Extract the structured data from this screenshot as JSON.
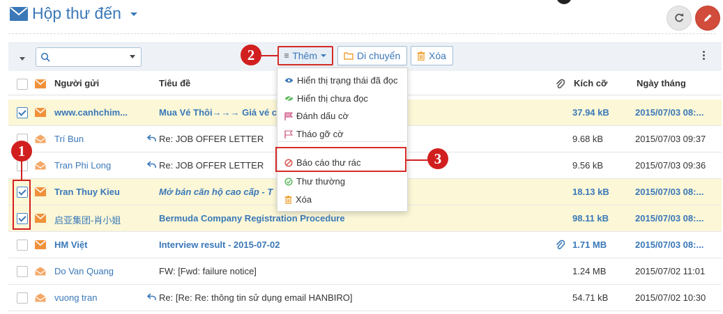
{
  "header": {
    "title": "Hộp thư đến",
    "icons": [
      "envelope-icon",
      "refresh-icon",
      "pencil-icon"
    ]
  },
  "toolbar": {
    "search_placeholder": "",
    "more_label": "Thêm",
    "move_label": "Di chuyển",
    "delete_label": "Xóa"
  },
  "columns": {
    "sender": "Người gửi",
    "subject": "Tiêu đề",
    "size": "Kích cỡ",
    "date": "Ngày tháng"
  },
  "menu": {
    "items": [
      {
        "label": "Hiển thị trạng thái đã đọc",
        "icon": "eye-icon",
        "color": "#3a78b8"
      },
      {
        "label": "Hiển thị chưa đọc",
        "icon": "eye-slash-icon",
        "color": "#5cb85c"
      },
      {
        "label": "Đánh dấu cờ",
        "icon": "flag-icon",
        "color": "#c94f7c"
      },
      {
        "label": "Tháo gỡ cờ",
        "icon": "flag-outline-icon",
        "color": "#c94f7c"
      },
      {
        "label": "Báo cáo thư rác",
        "icon": "ban-icon",
        "color": "#d9534f"
      },
      {
        "label": "Thư thường",
        "icon": "check-circle-icon",
        "color": "#5cb85c"
      },
      {
        "label": "Xóa",
        "icon": "trash-icon",
        "color": "#f0a030"
      }
    ]
  },
  "callouts": [
    "1",
    "2",
    "3"
  ],
  "rows": [
    {
      "sender": "www.canhchim...",
      "subject": "Mua Vé Thôi→→→ Giá vé ch",
      "size": "37.94 kB",
      "date": "2015/07/03 08:..."
    },
    {
      "sender": "Trí Bun",
      "subject": "Re: JOB OFFER LETTER",
      "size": "9.68 kB",
      "date": "2015/07/03 09:37"
    },
    {
      "sender": "Tran Phi Long",
      "subject": "Re: JOB OFFER LETTER",
      "size": "9.56 kB",
      "date": "2015/07/03 09:36"
    },
    {
      "sender": "Tran Thuy Kieu",
      "subject": "Mở bán căn hộ cao cấp - T",
      "size": "18.13 kB",
      "date": "2015/07/03 08:..."
    },
    {
      "sender": "启亚集团-肖小姐",
      "subject": "Bermuda Company Registration Procedure",
      "size": "98.11 kB",
      "date": "2015/07/03 08:..."
    },
    {
      "sender": "HM Việt",
      "subject": "Interview result - 2015-07-02",
      "size": "1.71 MB",
      "date": "2015/07/03 08:..."
    },
    {
      "sender": "Do Van Quang",
      "subject": "FW: [Fwd: failure notice]",
      "size": "1.24 MB",
      "date": "2015/07/02 11:01"
    },
    {
      "sender": "vuong tran",
      "subject": "Re: [Re: Re: thông tin sử dụng email HANBIRO]",
      "size": "54.71 kB",
      "date": "2015/07/02 10:30"
    }
  ]
}
